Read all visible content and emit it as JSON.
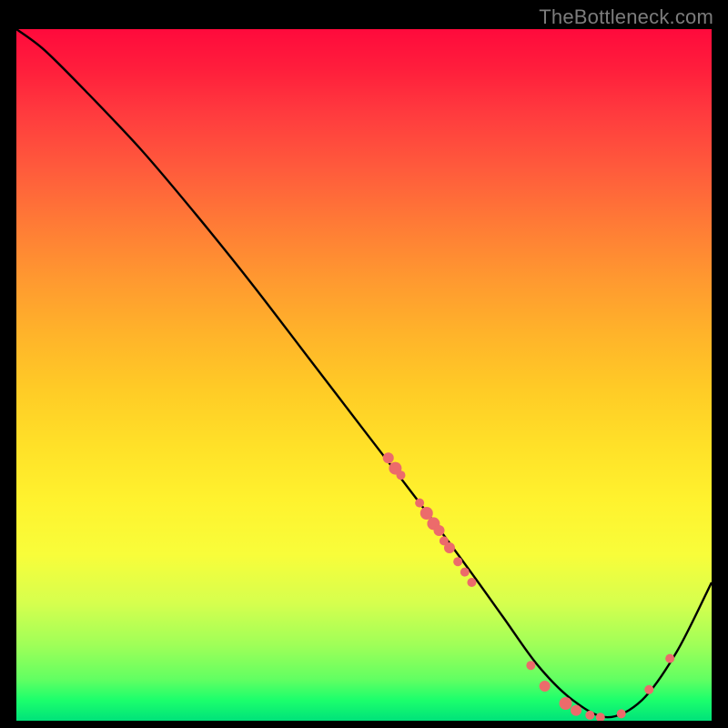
{
  "watermark": "TheBottleneck.com",
  "chart_data": {
    "type": "line",
    "title": "",
    "xlabel": "",
    "ylabel": "",
    "xlim": [
      0,
      100
    ],
    "ylim": [
      0,
      100
    ],
    "curve": {
      "x": [
        0,
        4,
        10,
        18,
        26,
        34,
        42,
        50,
        58,
        65,
        70,
        75,
        80,
        85,
        90,
        95,
        100
      ],
      "y": [
        100,
        97,
        91,
        82.5,
        73,
        63,
        52.5,
        42,
        31.5,
        22,
        15,
        8,
        3,
        0.5,
        3,
        10,
        20
      ]
    },
    "markers": [
      {
        "x": 53.5,
        "y": 38.0,
        "r": 6
      },
      {
        "x": 54.5,
        "y": 36.5,
        "r": 7
      },
      {
        "x": 55.3,
        "y": 35.5,
        "r": 5
      },
      {
        "x": 58.0,
        "y": 31.5,
        "r": 5
      },
      {
        "x": 59.0,
        "y": 30.0,
        "r": 7
      },
      {
        "x": 60.0,
        "y": 28.5,
        "r": 7
      },
      {
        "x": 60.8,
        "y": 27.5,
        "r": 6
      },
      {
        "x": 61.5,
        "y": 26.0,
        "r": 5
      },
      {
        "x": 62.3,
        "y": 25.0,
        "r": 6
      },
      {
        "x": 63.5,
        "y": 23.0,
        "r": 5
      },
      {
        "x": 64.5,
        "y": 21.5,
        "r": 5
      },
      {
        "x": 65.5,
        "y": 20.0,
        "r": 5
      },
      {
        "x": 74.0,
        "y": 8.0,
        "r": 5
      },
      {
        "x": 76.0,
        "y": 5.0,
        "r": 6
      },
      {
        "x": 79.0,
        "y": 2.5,
        "r": 7
      },
      {
        "x": 80.5,
        "y": 1.5,
        "r": 6
      },
      {
        "x": 82.5,
        "y": 0.8,
        "r": 5
      },
      {
        "x": 84.0,
        "y": 0.5,
        "r": 5
      },
      {
        "x": 87.0,
        "y": 1.0,
        "r": 5
      },
      {
        "x": 91.0,
        "y": 4.5,
        "r": 5
      },
      {
        "x": 94.0,
        "y": 9.0,
        "r": 5
      }
    ],
    "colors": {
      "curve_stroke": "#000000",
      "marker_fill": "#ec6b6b",
      "gradient_top": "#ff0a3c",
      "gradient_bottom": "#00e27a"
    }
  }
}
